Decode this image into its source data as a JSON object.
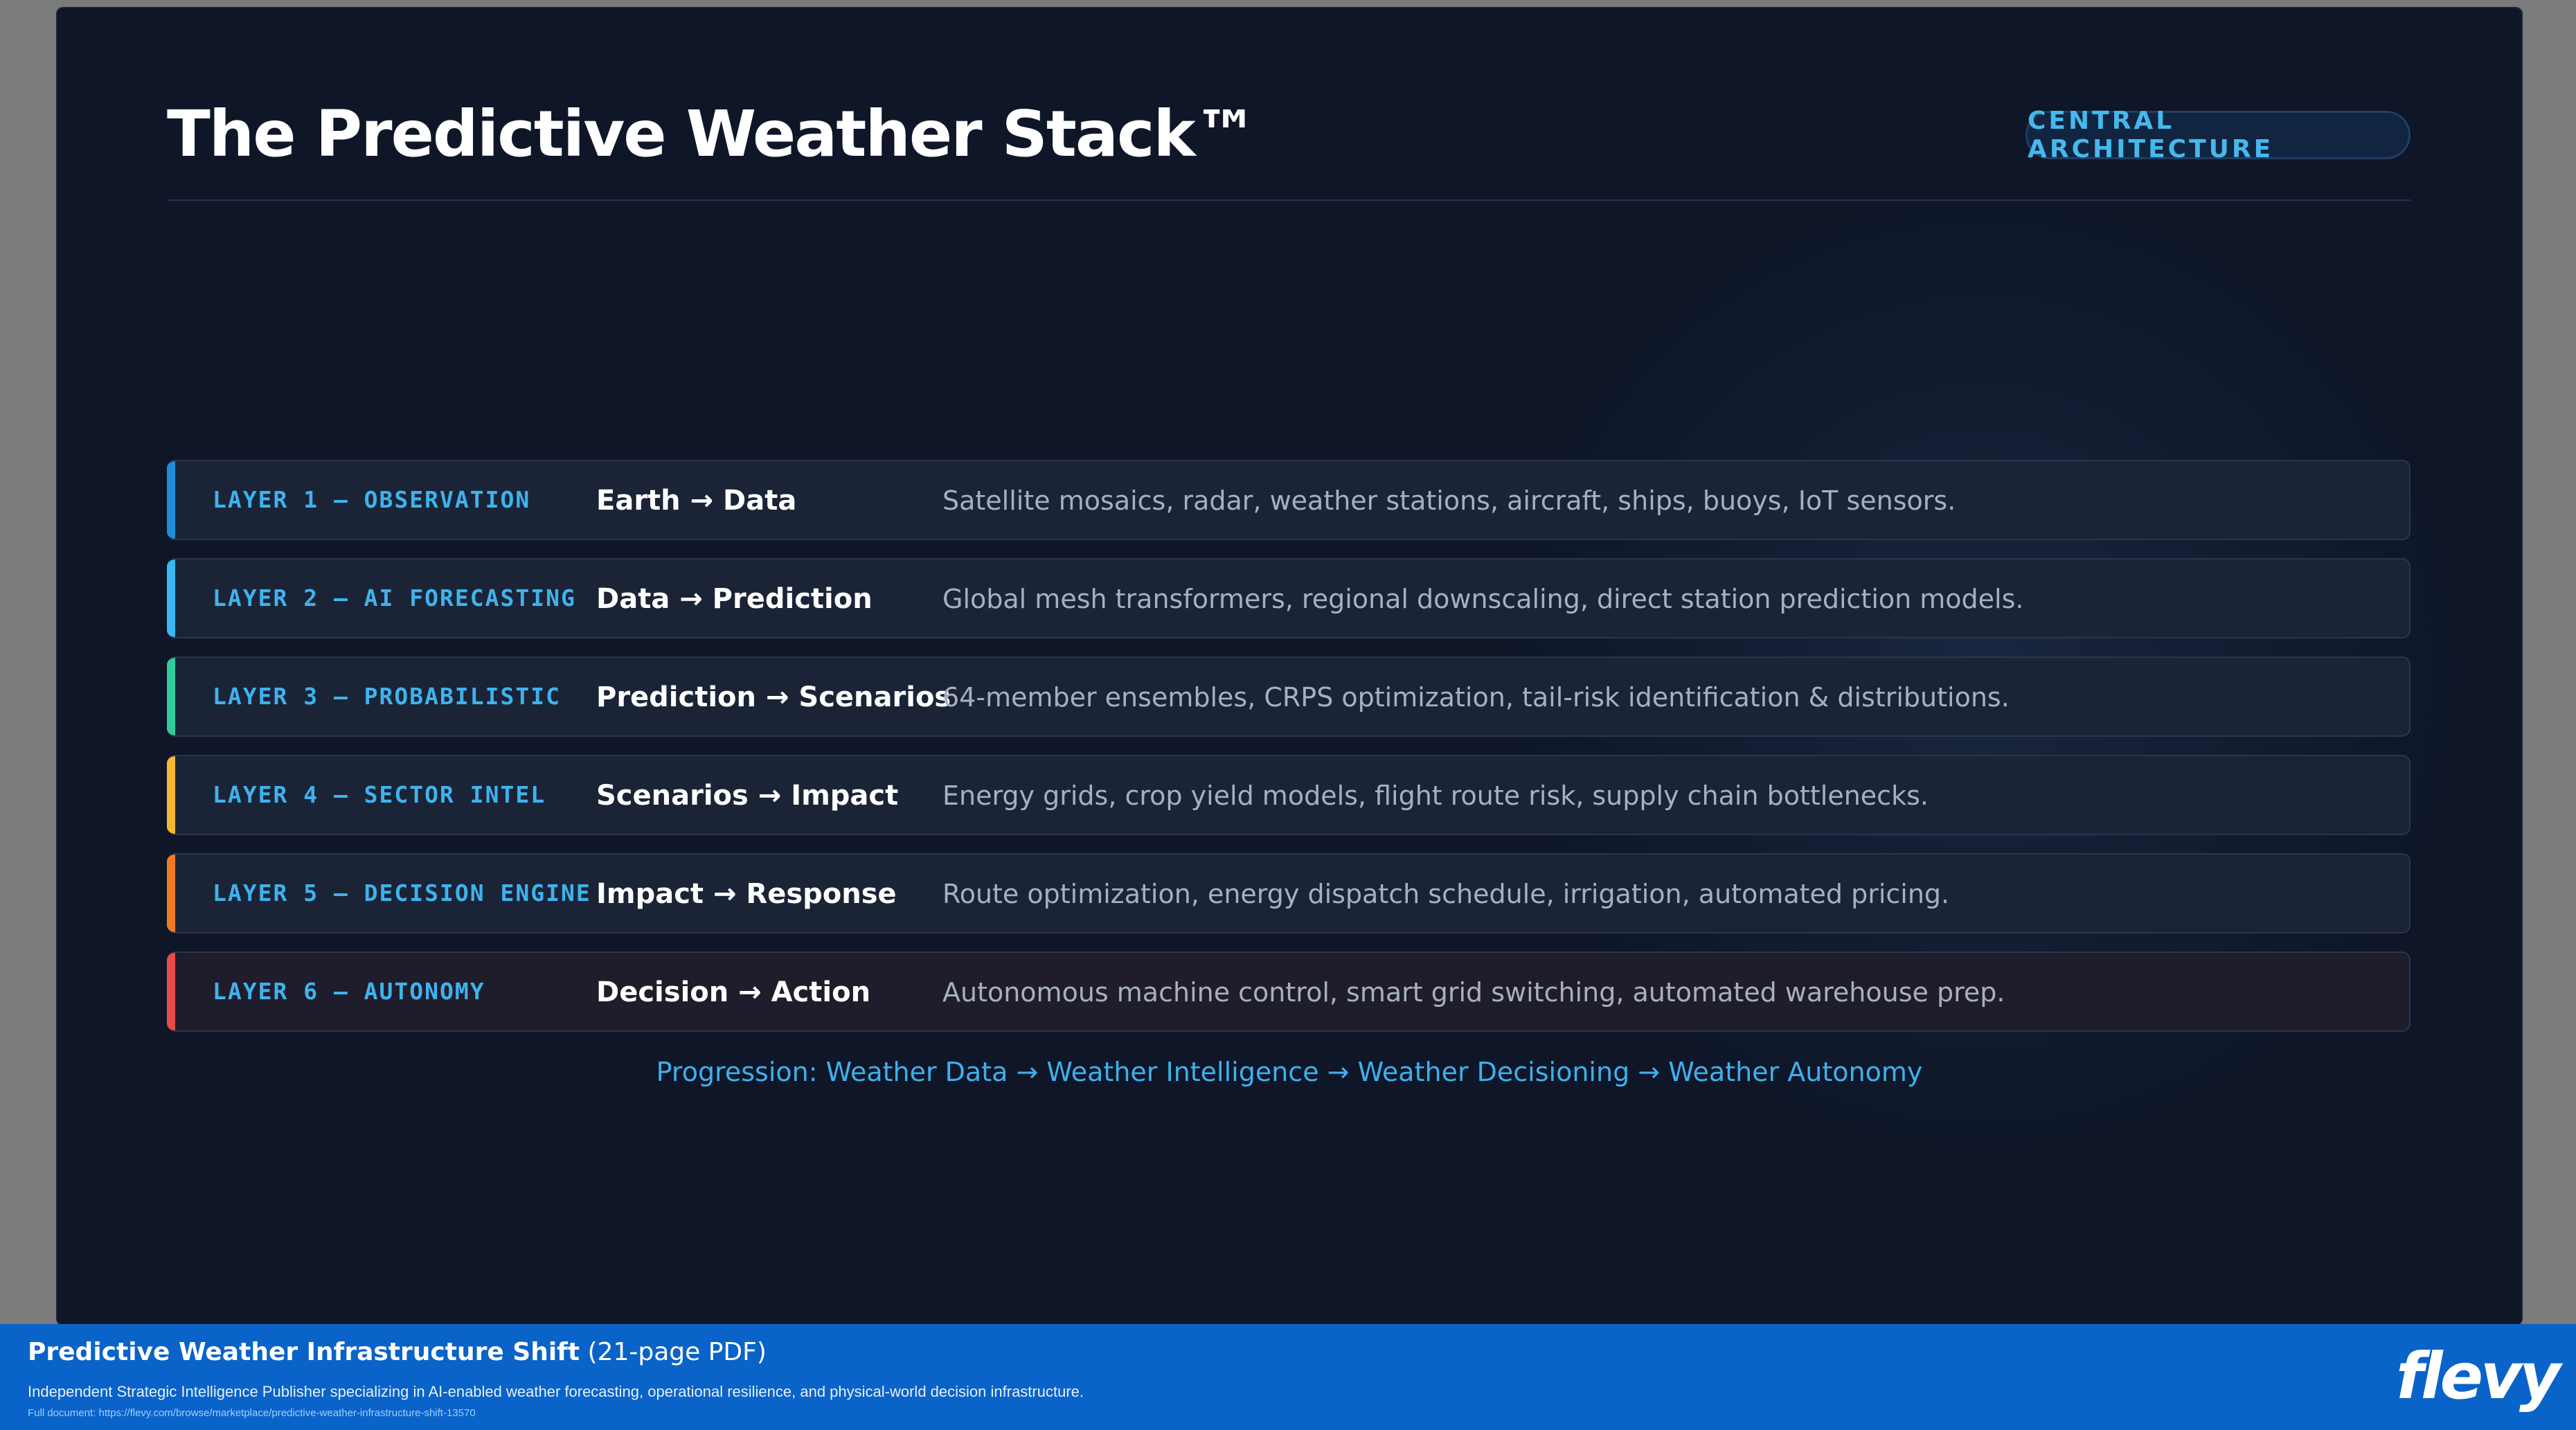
{
  "slide": {
    "title": "The Predictive Weather Stack™",
    "badge": "CENTRAL ARCHITECTURE",
    "layers": [
      {
        "name": "LAYER 1 — OBSERVATION",
        "flow": "Earth → Data",
        "description": "Satellite mosaics, radar, weather stations, aircraft, ships, buoys, IoT sensors.",
        "accent_color": "#1e8fd6"
      },
      {
        "name": "LAYER 2 — AI FORECASTING",
        "flow": "Data → Prediction",
        "description": "Global mesh transformers, regional downscaling, direct station prediction models.",
        "accent_color": "#3ab6f0"
      },
      {
        "name": "LAYER 3 — PROBABILISTIC",
        "flow": "Prediction → Scenarios",
        "description": "64-member ensembles, CRPS optimization, tail-risk identification & distributions.",
        "accent_color": "#2ecc9a"
      },
      {
        "name": "LAYER 4 — SECTOR INTEL",
        "flow": "Scenarios → Impact",
        "description": "Energy grids, crop yield models, flight route risk, supply chain bottlenecks.",
        "accent_color": "#f5b82e"
      },
      {
        "name": "LAYER 5 — DECISION ENGINE",
        "flow": "Impact → Response",
        "description": "Route optimization, energy dispatch schedule, irrigation, automated pricing.",
        "accent_color": "#f07a22"
      },
      {
        "name": "LAYER 6 — AUTONOMY",
        "flow": "Decision → Action",
        "description": "Autonomous machine control, smart grid switching, automated warehouse prep.",
        "accent_color": "#e84a4a"
      }
    ],
    "progression": "Progression: Weather Data → Weather Intelligence → Weather Decisioning → Weather Autonomy"
  },
  "footer": {
    "title": "Predictive Weather Infrastructure Shift",
    "pages": "(21-page PDF)",
    "description": "Independent Strategic Intelligence Publisher specializing in AI-enabled weather forecasting, operational resilience, and physical-world decision infrastructure.",
    "url": "Full document: https://flevy.com/browse/marketplace/predictive-weather-infrastructure-shift-13570",
    "logo": "flevy"
  }
}
